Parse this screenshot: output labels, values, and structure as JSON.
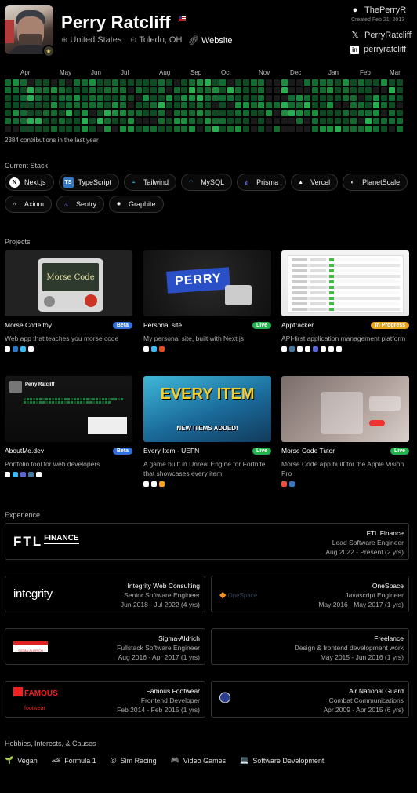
{
  "profile": {
    "name": "Perry Ratcliff",
    "country": "United States",
    "city": "Toledo, OH",
    "website_label": "Website",
    "github_user": "ThePerryR",
    "created": "Created Feb 21, 2013",
    "x_user": "PerryRatcliff",
    "linkedin_user": "perryratcliff"
  },
  "contributions": {
    "months": [
      "Apr",
      "May",
      "Jun",
      "Jul",
      "Aug",
      "Sep",
      "Oct",
      "Nov",
      "Dec",
      "Jan",
      "Feb",
      "Mar"
    ],
    "summary": "2384 contributions in the last year",
    "colors": [
      "#1a1a1a",
      "#0e4a22",
      "#136b30",
      "#1a8f3e",
      "#26b050"
    ]
  },
  "stack": {
    "title": "Current Stack",
    "items": [
      {
        "label": "Next.js",
        "icon": "nextjs-icon",
        "glyph": "N",
        "bg": "#fff",
        "fg": "#000"
      },
      {
        "label": "TypeScript",
        "icon": "typescript-icon",
        "glyph": "TS",
        "bg": "#3178c6",
        "fg": "#fff"
      },
      {
        "label": "Tailwind",
        "icon": "tailwind-icon",
        "glyph": "≈",
        "bg": "transparent",
        "fg": "#38bdf8"
      },
      {
        "label": "MySQL",
        "icon": "mysql-icon",
        "glyph": "◠",
        "bg": "transparent",
        "fg": "#4479a1"
      },
      {
        "label": "Prisma",
        "icon": "prisma-icon",
        "glyph": "◭",
        "bg": "transparent",
        "fg": "#5a67d8"
      },
      {
        "label": "Vercel",
        "icon": "vercel-icon",
        "glyph": "▲",
        "bg": "transparent",
        "fg": "#fff"
      },
      {
        "label": "PlanetScale",
        "icon": "planetscale-icon",
        "glyph": "◐",
        "bg": "transparent",
        "fg": "#fff"
      },
      {
        "label": "Axiom",
        "icon": "axiom-icon",
        "glyph": "△",
        "bg": "transparent",
        "fg": "#fff"
      },
      {
        "label": "Sentry",
        "icon": "sentry-icon",
        "glyph": "◬",
        "bg": "transparent",
        "fg": "#7b5cd6"
      },
      {
        "label": "Graphite",
        "icon": "graphite-icon",
        "glyph": "✹",
        "bg": "transparent",
        "fg": "#fff"
      }
    ]
  },
  "projects": {
    "title": "Projects",
    "items": [
      {
        "title": "Morse Code toy",
        "status": "Beta",
        "status_color": "#2f6fde",
        "desc": "Web app that teaches you morse code",
        "img_text": "Morse Code",
        "tech": [
          "#fff",
          "#3178c6",
          "#38bdf8",
          "#fff"
        ]
      },
      {
        "title": "Personal site",
        "status": "Live",
        "status_color": "#22b14c",
        "desc": "My personal site, built with Next.js",
        "img_text": "PERRY",
        "tech": [
          "#fff",
          "#38bdf8",
          "#e34c26"
        ]
      },
      {
        "title": "Apptracker",
        "status": "In Progress",
        "status_color": "#e8a21a",
        "desc": "API-first application management platform",
        "img_text": "",
        "tech": [
          "#fff",
          "#4479a1",
          "#fff",
          "#fff",
          "#5a67d8",
          "#fff",
          "#fff",
          "#fff"
        ]
      },
      {
        "title": "AboutMe.dev",
        "status": "Beta",
        "status_color": "#2f6fde",
        "desc": "Portfolio tool for web developers",
        "img_text": "Perry Ratcliff",
        "tech": [
          "#fff",
          "#38bdf8",
          "#5a67d8",
          "#4479a1",
          "#fff"
        ]
      },
      {
        "title": "Every Item - UEFN",
        "status": "Live",
        "status_color": "#22b14c",
        "desc": "A game built in Unreal Engine for Fortnite that showcases every item",
        "img_text": "EVERY ITEM",
        "img_sub": "NEW ITEMS ADDED!",
        "tech": [
          "#fff",
          "#fff",
          "#f7a31c"
        ]
      },
      {
        "title": "Morse Code Tutor",
        "status": "Live",
        "status_color": "#22b14c",
        "desc": "Morse Code app built for the Apple Vision Pro",
        "img_text": "",
        "tech": [
          "#f05138",
          "#3178c6"
        ]
      }
    ]
  },
  "experience": {
    "title": "Experience",
    "items": [
      {
        "company": "FTL Finance",
        "role": "Lead Software Engineer",
        "dates": "Aug 2022 - Present (2 yrs)",
        "logo": "FTL",
        "logo_sub": "FINANCE"
      },
      {
        "company": "Integrity Web Consulting",
        "role": "Senior Software Engineer",
        "dates": "Jun 2018 - Jul 2022 (4 yrs)",
        "logo": "integrity"
      },
      {
        "company": "OneSpace",
        "role": "Javascript Engineer",
        "dates": "May 2016 - May 2017 (1 yrs)",
        "logo": "OneSpace"
      },
      {
        "company": "Sigma-Aldrich",
        "role": "Fullstack Software Engineer",
        "dates": "Aug 2016 - Apr 2017 (1 yrs)",
        "logo": "SIGMA-ALDRICH"
      },
      {
        "company": "Freelance",
        "role": "Design & frontend development work",
        "dates": "May 2015 - Jun 2016 (1 yrs)",
        "logo": ""
      },
      {
        "company": "Famous Footwear",
        "role": "Frontend Developer",
        "dates": "Feb 2014 - Feb 2015 (1 yrs)",
        "logo": "FAMOUS",
        "logo_sub": "footwear"
      },
      {
        "company": "Air National Guard",
        "role": "Combat Communications",
        "dates": "Apr 2009 - Apr 2015 (6 yrs)",
        "logo": ""
      }
    ]
  },
  "hobbies": {
    "title": "Hobbies, Interests, & Causes",
    "items": [
      {
        "label": "Vegan",
        "icon": "sprout-icon",
        "glyph": "🌱"
      },
      {
        "label": "Formula 1",
        "icon": "race-car-icon",
        "glyph": "🏎"
      },
      {
        "label": "Sim Racing",
        "icon": "steering-wheel-icon",
        "glyph": "◎"
      },
      {
        "label": "Video Games",
        "icon": "gamepad-icon",
        "glyph": "🎮"
      },
      {
        "label": "Software Development",
        "icon": "laptop-icon",
        "glyph": "💻"
      }
    ]
  }
}
